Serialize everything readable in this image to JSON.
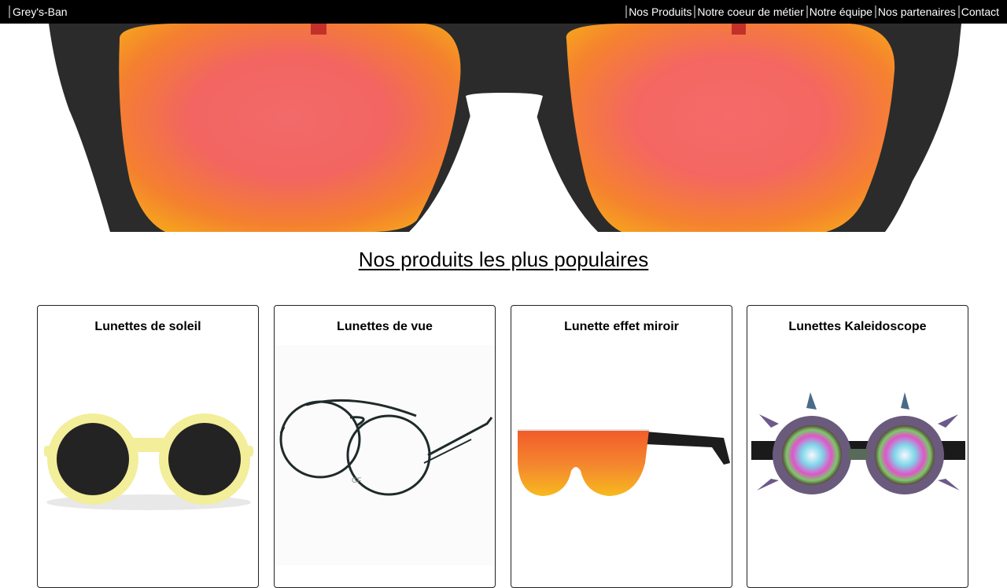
{
  "header": {
    "brand": "Grey's-Ban",
    "nav": [
      {
        "label": "Nos Produits"
      },
      {
        "label": "Notre coeur de métier"
      },
      {
        "label": "Notre équipe"
      },
      {
        "label": "Nos partenaires"
      },
      {
        "label": "Contact"
      }
    ]
  },
  "main": {
    "section_title": "Nos produits les plus populaires",
    "products": [
      {
        "title": "Lunettes de soleil"
      },
      {
        "title": "Lunettes de vue"
      },
      {
        "title": "Lunette effet miroir"
      },
      {
        "title": "Lunettes Kaleidoscope"
      }
    ]
  }
}
